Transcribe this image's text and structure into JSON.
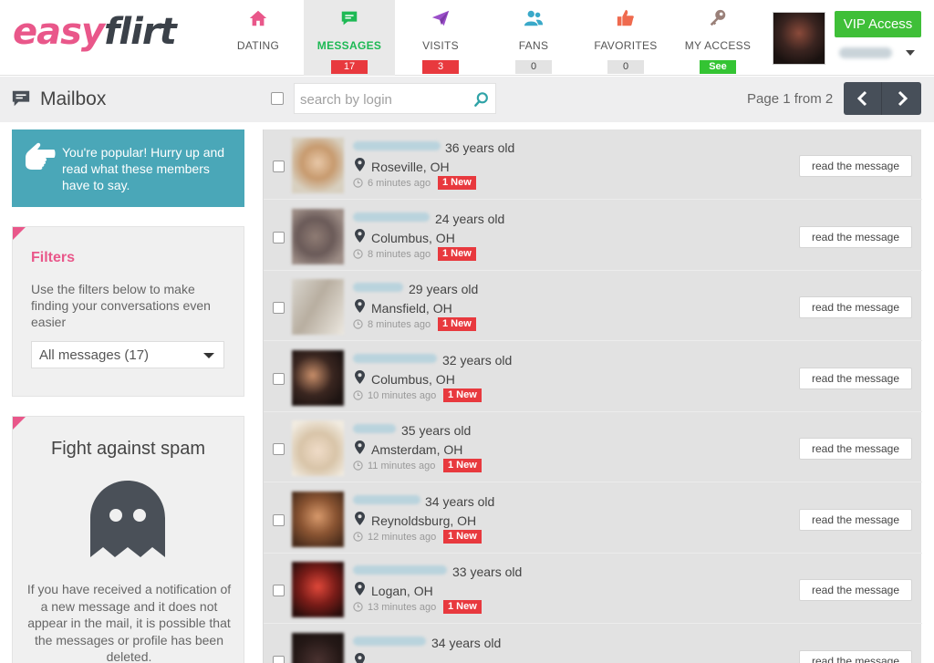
{
  "brand": {
    "part1": "easy",
    "part2": "flirt"
  },
  "nav": [
    {
      "label": "DATING",
      "icon": "home-icon",
      "badge": ""
    },
    {
      "label": "MESSAGES",
      "icon": "chat-icon",
      "badge": "17"
    },
    {
      "label": "VISITS",
      "icon": "paper-plane-icon",
      "badge": "3"
    },
    {
      "label": "FANS",
      "icon": "users-icon",
      "badge": "0"
    },
    {
      "label": "FAVORITES",
      "icon": "thumbs-up-icon",
      "badge": "0"
    },
    {
      "label": "MY ACCESS",
      "icon": "key-icon",
      "badge": "See"
    }
  ],
  "user": {
    "vip_label": "VIP Access"
  },
  "mailbox": {
    "title": "Mailbox",
    "search_placeholder": "search by login",
    "page_info": "Page 1 from 2"
  },
  "popular": {
    "text": "You're popular! Hurry up and read what these members have to say."
  },
  "filters": {
    "title": "Filters",
    "description": "Use the filters below to make finding your conversations even easier",
    "selected": "All messages (17)"
  },
  "spam": {
    "title": "Fight against spam",
    "text": "If you have received a notification of a new message and it does not appear in the mail, it is possible that the messages or profile has been deleted."
  },
  "messages": [
    {
      "age": "36 years old",
      "city": "Roseville, OH",
      "time": "6 minutes ago",
      "badge": "1 New",
      "button": "read the message"
    },
    {
      "age": "24 years old",
      "city": "Columbus, OH",
      "time": "8 minutes ago",
      "badge": "1 New",
      "button": "read the message"
    },
    {
      "age": "29 years old",
      "city": "Mansfield, OH",
      "time": "8 minutes ago",
      "badge": "1 New",
      "button": "read the message"
    },
    {
      "age": "32 years old",
      "city": "Columbus, OH",
      "time": "10 minutes ago",
      "badge": "1 New",
      "button": "read the message"
    },
    {
      "age": "35 years old",
      "city": "Amsterdam, OH",
      "time": "11 minutes ago",
      "badge": "1 New",
      "button": "read the message"
    },
    {
      "age": "34 years old",
      "city": "Reynoldsburg, OH",
      "time": "12 minutes ago",
      "badge": "1 New",
      "button": "read the message"
    },
    {
      "age": "33 years old",
      "city": "Logan, OH",
      "time": "13 minutes ago",
      "badge": "1 New",
      "button": "read the message"
    },
    {
      "age": "34 years old",
      "city": "",
      "time": "",
      "badge": "",
      "button": "read the message"
    }
  ],
  "colors": {
    "brand_pink": "#e9578a",
    "accent_green": "#1db954",
    "badge_red": "#e8393e",
    "info_teal": "#4aa7b8"
  }
}
